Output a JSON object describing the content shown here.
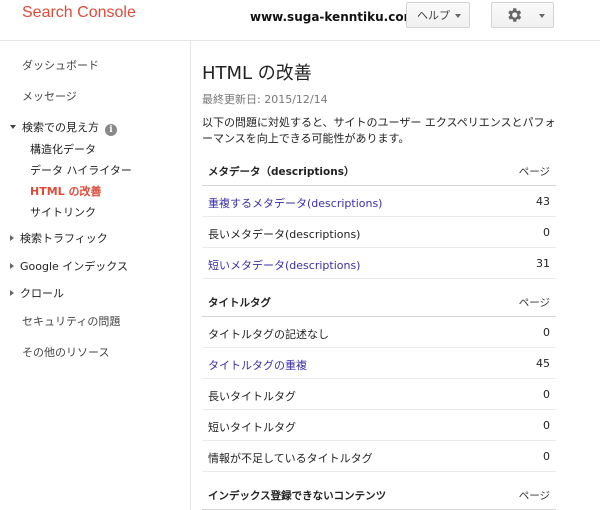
{
  "header": {
    "brand": "Search Console",
    "watermark": "www.suga-kenntiku.com",
    "help_label": "ヘルプ",
    "settings_icon": "gear-icon"
  },
  "sidebar": {
    "dashboard": "ダッシュボード",
    "messages": "メッセージ",
    "search_appearance": "検索での見え方",
    "search_appearance_sub": [
      "構造化データ",
      "データ ハイライター",
      "HTML の改善",
      "サイトリンク"
    ],
    "search_traffic": "検索トラフィック",
    "google_index": "Google インデックス",
    "crawl": "クロール",
    "security": "セキュリティの問題",
    "other_resources": "その他のリソース"
  },
  "main": {
    "title": "HTML の改善",
    "last_updated": "最終更新日: 2015/12/14",
    "description": "以下の問題に対処すると、サイトのユーザー エクスペリエンスとパフォーマンスを向上できる可能性があります。",
    "meta_section": {
      "header": "メタデータ（descriptions）",
      "pages_label": "ページ",
      "rows": [
        {
          "label": "重複するメタデータ(descriptions)",
          "value": "43"
        },
        {
          "label": "長いメタデータ(descriptions)",
          "value": "0"
        },
        {
          "label": "短いメタデータ(descriptions)",
          "value": "31"
        }
      ]
    },
    "title_section": {
      "header": "タイトルタグ",
      "pages_label": "ページ",
      "rows": [
        {
          "label": "タイトルタグの記述なし",
          "value": "0"
        },
        {
          "label": "タイトルタグの重複",
          "value": "45"
        },
        {
          "label": "長いタイトルタグ",
          "value": "0"
        },
        {
          "label": "短いタイトルタグ",
          "value": "0"
        },
        {
          "label": "情報が不足しているタイトルタグ",
          "value": "0"
        }
      ]
    },
    "index_section": {
      "header": "インデックス登録できないコンテンツ",
      "pages_label": "ページ"
    }
  }
}
